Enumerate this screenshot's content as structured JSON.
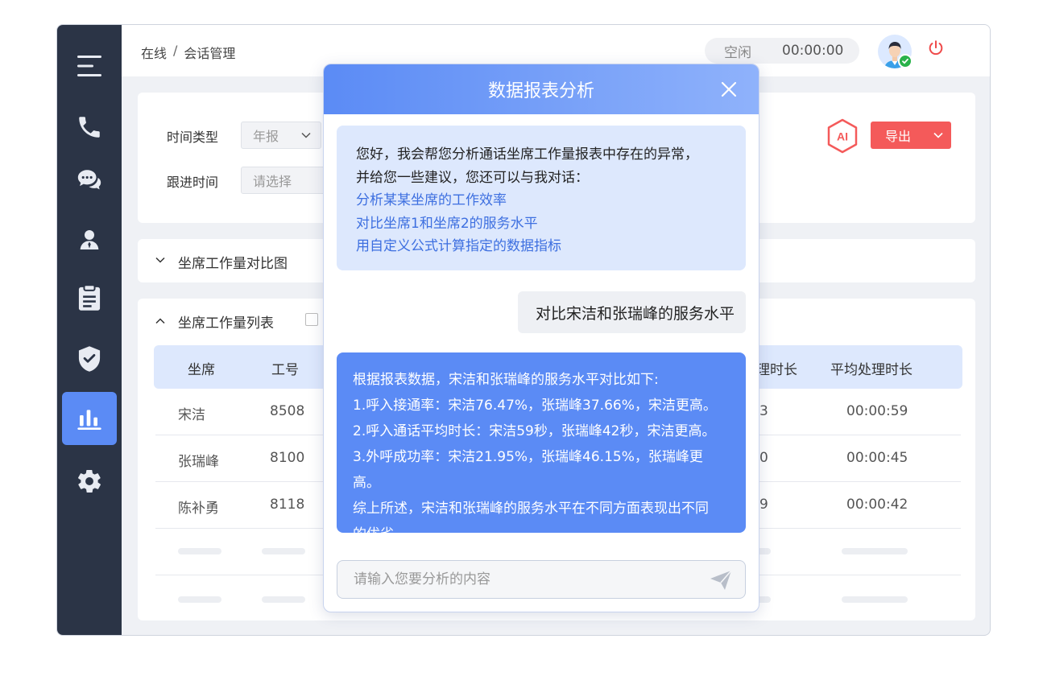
{
  "header": {
    "breadcrumb": [
      "在线",
      "会话管理"
    ],
    "breadcrumb_sep": "/",
    "status": "空闲",
    "timer": "00:00:00"
  },
  "sidebar": {
    "items": [
      {
        "icon": "menu-icon"
      },
      {
        "icon": "phone-icon"
      },
      {
        "icon": "chat-icon"
      },
      {
        "icon": "user-icon"
      },
      {
        "icon": "clipboard-icon"
      },
      {
        "icon": "shield-icon"
      },
      {
        "icon": "bar-chart-icon",
        "active": true
      },
      {
        "icon": "gear-icon"
      }
    ]
  },
  "filters": {
    "time_type_label": "时间类型",
    "time_type_value": "年报",
    "followup_label": "跟进时间",
    "followup_placeholder": "请选择",
    "ai_label": "AI",
    "export_label": "导出"
  },
  "chart_section": {
    "title": "坐席工作量对比图"
  },
  "list_section": {
    "title": "坐席工作量列表",
    "columns": [
      "坐席",
      "工号",
      "理时长",
      "平均处理时长"
    ],
    "rows": [
      {
        "agent": "宋洁",
        "id": "8508",
        "partial": "3",
        "avg": "00:00:59"
      },
      {
        "agent": "张瑞峰",
        "id": "8100",
        "partial": "0",
        "avg": "00:00:45"
      },
      {
        "agent": "陈补勇",
        "id": "8118",
        "partial": "9",
        "avg": "00:00:42"
      }
    ]
  },
  "dialog": {
    "title": "数据报表分析",
    "intro_line1": "您好，我会帮您分析通话坐席工作量报表中存在的异常，",
    "intro_line2": "并给您一些建议，您还可以与我对话：",
    "suggestions": [
      "分析某某坐席的工作效率",
      "对比坐席1和坐席2的服务水平",
      "用自定义公式计算指定的数据指标"
    ],
    "user_message": "对比宋洁和张瑞峰的服务水平",
    "reply_lines": [
      "根据报表数据，宋洁和张瑞峰的服务水平对比如下:",
      "1.呼入接通率：宋洁76.47%，张瑞峰37.66%，宋洁更高。",
      "2.呼入通话平均时长：宋洁59秒，张瑞峰42秒，宋洁更高。",
      "3.外呼成功率：宋洁21.95%，张瑞峰46.15%，张瑞峰更高。",
      "综上所述，宋洁和张瑞峰的服务水平在不同方面表现出不同",
      "的优劣。"
    ],
    "input_placeholder": "请输入您要分析的内容"
  },
  "colors": {
    "sidebar_bg": "#2b3446",
    "accent": "#5b8bf5",
    "export_red": "#f45a5a",
    "online_green": "#29b24a"
  }
}
